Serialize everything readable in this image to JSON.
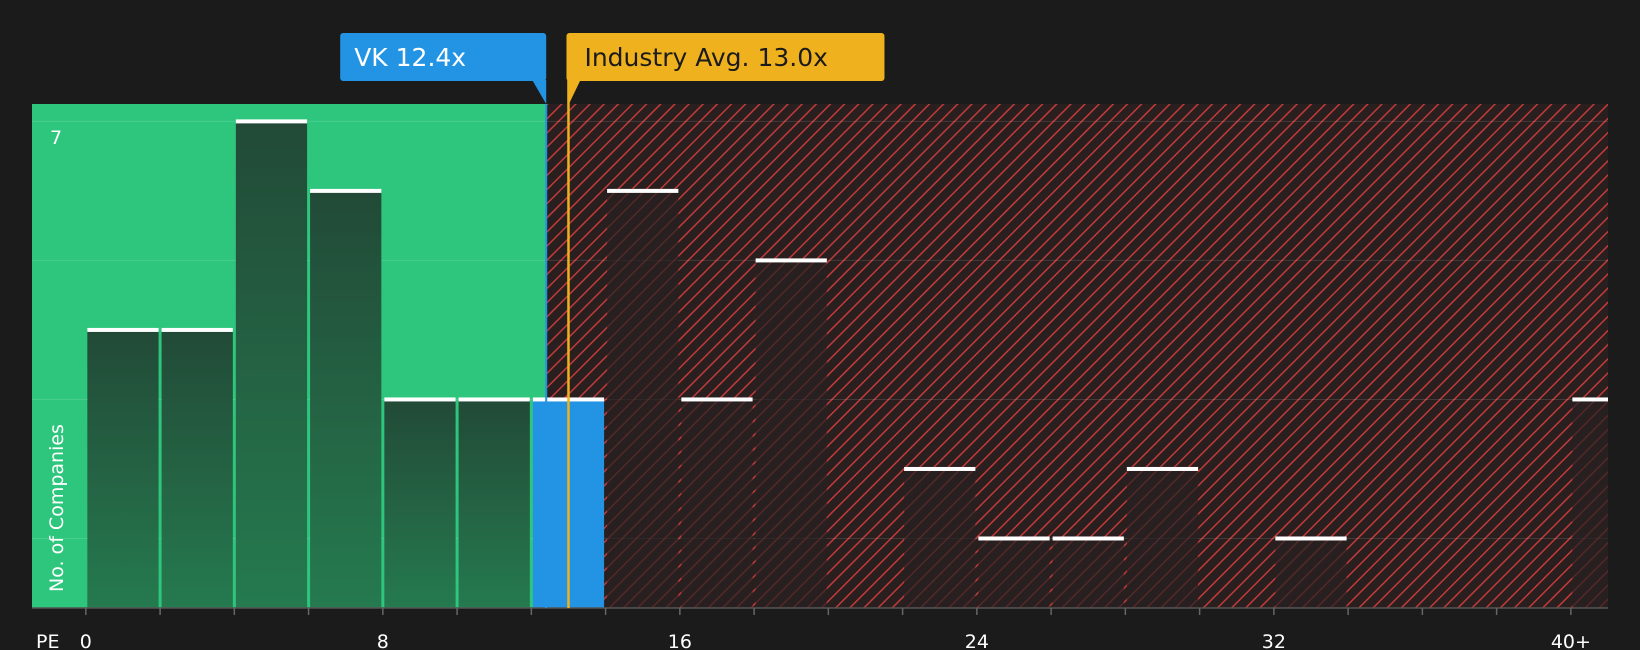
{
  "chart_data": {
    "type": "bar",
    "xlabel": "PE",
    "ylabel": "No. of Companies",
    "x_ticks": [
      "0",
      "8",
      "16",
      "24",
      "32",
      "40+"
    ],
    "x_tick_values": [
      0,
      8,
      16,
      24,
      32,
      40
    ],
    "y_tick_labels": [
      "7"
    ],
    "ylim": [
      0,
      7.25
    ],
    "xlim": [
      -1.45,
      41.0
    ],
    "bin_width": 2,
    "series": [
      {
        "values": [
          {
            "bin_start": 0,
            "count": 4
          },
          {
            "bin_start": 2,
            "count": 4
          },
          {
            "bin_start": 4,
            "count": 7
          },
          {
            "bin_start": 6,
            "count": 6
          },
          {
            "bin_start": 8,
            "count": 3
          },
          {
            "bin_start": 10,
            "count": 3
          },
          {
            "bin_start": 12,
            "count": 3,
            "highlight": true
          },
          {
            "bin_start": 14,
            "count": 6
          },
          {
            "bin_start": 16,
            "count": 3
          },
          {
            "bin_start": 18,
            "count": 5
          },
          {
            "bin_start": 20,
            "count": 0
          },
          {
            "bin_start": 22,
            "count": 2
          },
          {
            "bin_start": 24,
            "count": 1
          },
          {
            "bin_start": 26,
            "count": 1
          },
          {
            "bin_start": 28,
            "count": 2
          },
          {
            "bin_start": 30,
            "count": 0
          },
          {
            "bin_start": 32,
            "count": 1
          },
          {
            "bin_start": 34,
            "count": 0
          },
          {
            "bin_start": 36,
            "count": 0
          },
          {
            "bin_start": 38,
            "count": 0
          },
          {
            "bin_start": 40,
            "count": 3
          }
        ]
      }
    ],
    "markers": {
      "company": {
        "label": "VK 12.4x",
        "value": 12.4
      },
      "industry": {
        "label": "Industry Avg. 13.0x",
        "value": 13.0
      }
    },
    "grid": true
  },
  "colors": {
    "background": "#1b1b1b",
    "undervalued_zone": "#2ec67d",
    "overvalued_zone": "#2a1f1f",
    "hatch": "#c23a3a",
    "bar_green_top": "#224a37",
    "bar_green_bottom": "#257a4f",
    "bar_red": "#2c2727",
    "highlight_bar": "#2394e3",
    "company_badge": "#2394e3",
    "industry_badge": "#efb11e",
    "bar_cap": "#ffffff"
  }
}
